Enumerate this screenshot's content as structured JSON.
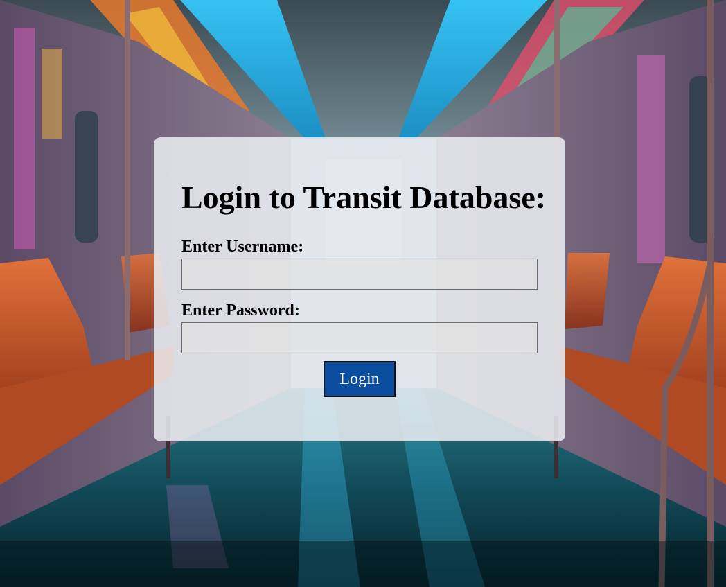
{
  "login": {
    "title": "Login to Transit Database:",
    "username_label": "Enter Username:",
    "username_value": "",
    "password_label": "Enter Password:",
    "password_value": "",
    "button_label": "Login"
  },
  "colors": {
    "button_background": "#0b4d9f",
    "card_background": "#ebeef2",
    "floor": "#0f3f4a",
    "seat": "#c8562a",
    "ceiling_light": "#3fc7f0"
  }
}
